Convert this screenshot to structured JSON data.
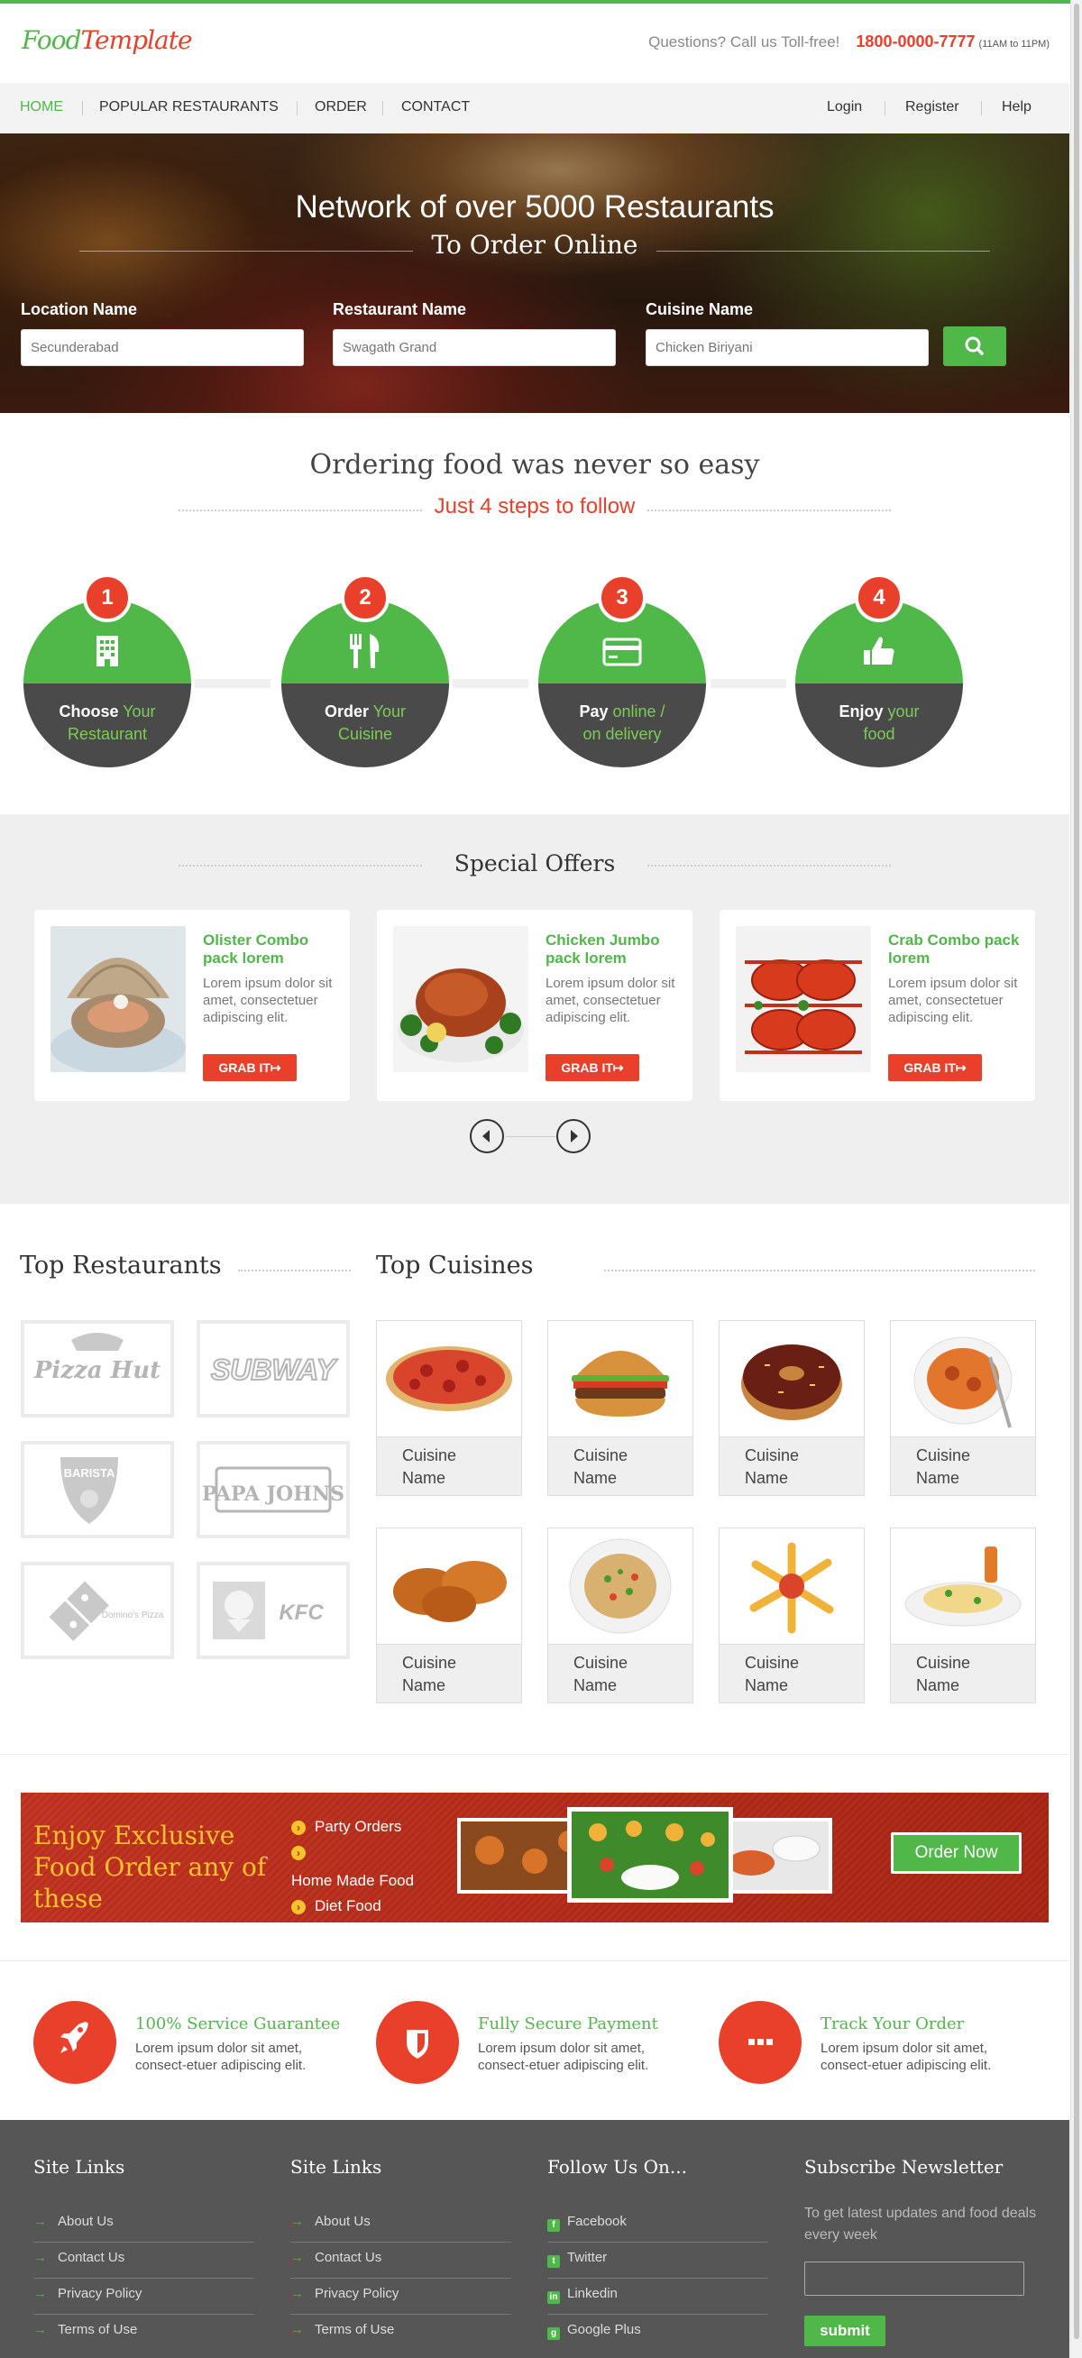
{
  "header": {
    "logo_part1": "Food",
    "logo_part2": "Template",
    "questions": "Questions? Call us Toll-free!",
    "phone": "1800-0000-7777",
    "hours": "(11AM to 11PM)"
  },
  "nav": {
    "left": [
      {
        "label": "HOME"
      },
      {
        "label": "POPULAR RESTAURANTS"
      },
      {
        "label": "ORDER"
      },
      {
        "label": "CONTACT"
      }
    ],
    "right": [
      {
        "label": "Login"
      },
      {
        "label": "Register"
      },
      {
        "label": "Help"
      }
    ]
  },
  "hero": {
    "title": "Network of over 5000 Restaurants",
    "subtitle": "To Order Online",
    "location_label": "Location Name",
    "location_placeholder": "Secunderabad",
    "restaurant_label": "Restaurant Name",
    "restaurant_placeholder": "Swagath Grand",
    "cuisine_label": "Cuisine Name",
    "cuisine_placeholder": "Chicken Biriyani"
  },
  "steps": {
    "title": "Ordering food was never so easy",
    "subtitle": "Just 4 steps to follow",
    "items": [
      {
        "num": "1",
        "bold": "Choose",
        "rest1": "Your",
        "rest2": "Restaurant"
      },
      {
        "num": "2",
        "bold": "Order",
        "rest1": "Your",
        "rest2": "Cuisine"
      },
      {
        "num": "3",
        "bold": "Pay",
        "rest1": "online /",
        "rest2": "on delivery"
      },
      {
        "num": "4",
        "bold": "Enjoy",
        "rest1": "your",
        "rest2": "food"
      }
    ]
  },
  "offers": {
    "title": "Special Offers",
    "items": [
      {
        "title": "Olister Combo pack lorem",
        "desc": "Lorem ipsum dolor sit amet, consectetuer adipiscing elit.",
        "button": "GRAB IT"
      },
      {
        "title": "Chicken Jumbo pack lorem",
        "desc": "Lorem ipsum dolor sit amet, consectetuer adipiscing elit.",
        "button": "GRAB IT"
      },
      {
        "title": "Crab Combo pack lorem",
        "desc": "Lorem ipsum dolor sit amet, consectetuer adipiscing elit.",
        "button": "GRAB IT"
      }
    ]
  },
  "restaurants": {
    "title": "Top Restaurants",
    "logos": [
      "Pizza Hut",
      "SUBWAY",
      "BARISTA",
      "PAPA JOHNS",
      "Domino's Pizza",
      "KFC"
    ]
  },
  "cuisines": {
    "title": "Top Cuisines",
    "items": [
      {
        "l1": "Cuisine",
        "l2": "Name"
      },
      {
        "l1": "Cuisine",
        "l2": "Name"
      },
      {
        "l1": "Cuisine",
        "l2": "Name"
      },
      {
        "l1": "Cuisine",
        "l2": "Name"
      },
      {
        "l1": "Cuisine",
        "l2": "Name"
      },
      {
        "l1": "Cuisine",
        "l2": "Name"
      },
      {
        "l1": "Cuisine",
        "l2": "Name"
      },
      {
        "l1": "Cuisine",
        "l2": "Name"
      }
    ]
  },
  "banner": {
    "text": "Enjoy Exclusive Food Order any of these",
    "items": [
      "Party Orders",
      "",
      "Home Made Food",
      "Diet Food"
    ],
    "button": "Order Now"
  },
  "features": [
    {
      "title": "100% Service Guarantee",
      "text": "Lorem ipsum dolor sit amet, consect-etuer adipiscing elit."
    },
    {
      "title": "Fully Secure Payment",
      "text": "Lorem ipsum dolor sit amet, consect-etuer adipiscing elit."
    },
    {
      "title": "Track Your Order",
      "text": "Lorem ipsum dolor sit amet, consect-etuer adipiscing elit."
    }
  ],
  "footer": {
    "col1_title": "Site Links",
    "col1_links": [
      "About Us",
      "Contact Us",
      "Privacy Policy",
      "Terms of Use"
    ],
    "col2_title": "Site Links",
    "col2_links": [
      "About Us",
      "Contact Us",
      "Privacy Policy",
      "Terms of Use"
    ],
    "col3_title": "Follow Us On...",
    "col3_links": [
      "Facebook",
      "Twitter",
      "Linkedin",
      "Google Plus"
    ],
    "col4_title": "Subscribe Newsletter",
    "newsletter_text": "To get latest updates and food deals every week",
    "submit": "submit"
  },
  "colors": {
    "green": "#4fb848",
    "red": "#e8402a",
    "dark": "#4a4a4a",
    "footer": "#565656"
  }
}
